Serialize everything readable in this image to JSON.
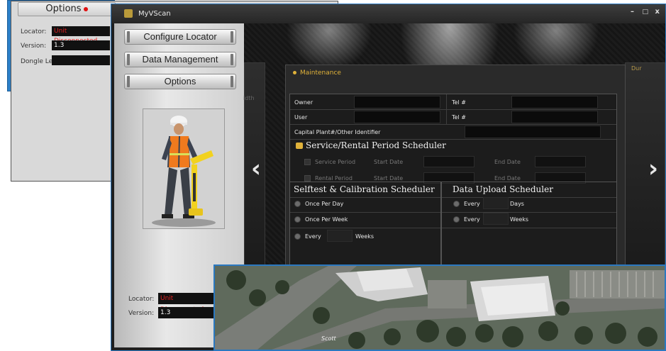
{
  "bg_window": {
    "options_label": "Options",
    "locator_label": "Locator:",
    "locator_value": "Unit Disconnected",
    "version_label": "Version:",
    "version_value": "1.3",
    "dongle_label": "Dongle Level:"
  },
  "window": {
    "title": "MyVScan",
    "minimize": "–",
    "maximize": "□",
    "close": "x"
  },
  "sidebar": {
    "buttons": [
      "Configure Locator",
      "Data Management",
      "Options"
    ],
    "locator_label": "Locator:",
    "locator_value": "Unit Disconnected",
    "version_label": "Version:",
    "version_value": "1.3"
  },
  "maintenance": {
    "title": "Maintenance",
    "owner_label": "Owner",
    "user_label": "User",
    "tel1_label": "Tel #",
    "tel2_label": "Tel #",
    "capital_label": "Capital Plant#/Other Identifier",
    "service_section": "Service/Rental Period Scheduler",
    "service_period": "Service Period",
    "rental_period": "Rental Period",
    "start_date": "Start Date",
    "end_date": "End Date",
    "selftest_section": "Selftest & Calibration Scheduler",
    "once_per_day": "Once Per Day",
    "once_per_week": "Once Per Week",
    "every": "Every",
    "weeks": "Weeks",
    "upload_section": "Data Upload Scheduler",
    "days": "Days"
  },
  "stage": {
    "left_card_text": "idth",
    "right_card_text": "Dur",
    "prev_arrow": "‹",
    "next_arrow": "›"
  },
  "map": {
    "street_label": "Scott"
  },
  "colors": {
    "accent": "#e0b23a",
    "error": "#e02020",
    "window_border": "#2b78c0"
  }
}
